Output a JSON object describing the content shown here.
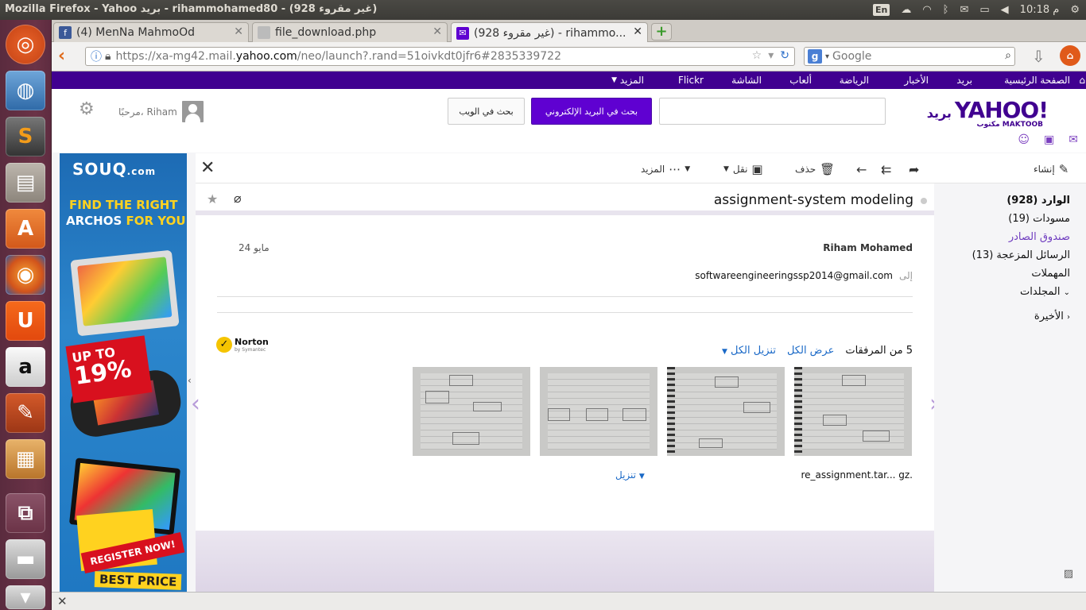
{
  "os": {
    "window_title": "Mozilla Firefox - Yahoo بريد - rihammohamed80 - (928 غير مقروء)",
    "keyboard_layout": "En",
    "clock": "10:18 م"
  },
  "browser": {
    "tabs": [
      {
        "title": "(4) MenNa MahmoOd",
        "favicon": "facebook-icon",
        "active": false
      },
      {
        "title": "file_download.php",
        "favicon": "page-icon",
        "active": false
      },
      {
        "title": "(928 غير مقروء) - rihammo...",
        "favicon": "mail-icon",
        "active": true
      }
    ],
    "url_prefix": "https://xa-mg42.mail.",
    "url_host": "yahoo.com",
    "url_suffix": "/neo/launch?.rand=51oivkdt0jfr6#2835339722",
    "search_placeholder": "Google"
  },
  "yahoo_nav": {
    "items": [
      "الصفحة الرئيسية",
      "بريد",
      "الأخبار",
      "الرياضة",
      "ألعاب",
      "الشاشة",
      "Flickr",
      "المزيد"
    ]
  },
  "header": {
    "logo_text": "YAHOO!",
    "logo_ar": "بريد",
    "logo_sub": "مكتوب MAKTOOB",
    "search_mail_button": "بحث في البريد الإلكتروني",
    "search_web_button": "بحث في الويب",
    "greeting": "مرحبًا، Riham"
  },
  "ad": {
    "brand": "SOUQ",
    "brand_suffix": ".com",
    "line1": "FIND THE RIGHT",
    "line2_a": "ARCHOS",
    "line2_b": "FOR YOU",
    "upto": "UP TO",
    "percent": "19%",
    "register": "REGISTER NOW!",
    "best_price": "BEST PRICE"
  },
  "toolbar": {
    "compose": "إنشاء",
    "delete": "حذف",
    "move": "نقل",
    "more": "المزيد"
  },
  "message": {
    "subject": "assignment-system modeling",
    "sender": "Riham Mohamed",
    "date": "24 مايو",
    "to_label": "إلى",
    "to_address": "softwareengineeringssp2014@gmail.com",
    "attachments_count": "5 من المرفقات",
    "view_all": "عرض الكل",
    "download_all": "تنزيل الكل",
    "norton": "Norton",
    "norton_sub": "by Symantec",
    "file_name": "re_assignment.tar... gz.",
    "download": "تنزيل"
  },
  "folders": [
    {
      "label": "الوارد (928)",
      "style": "bold"
    },
    {
      "label": "مسودات (19)",
      "style": "normal"
    },
    {
      "label": "صندوق الصادر",
      "style": "purple"
    },
    {
      "label": "الرسائل المزعجة (13)",
      "style": "normal"
    },
    {
      "label": "المهملات",
      "style": "normal"
    },
    {
      "label": "المجلدات",
      "style": "normal"
    },
    {
      "label": "الأخيرة",
      "style": "normal"
    }
  ]
}
